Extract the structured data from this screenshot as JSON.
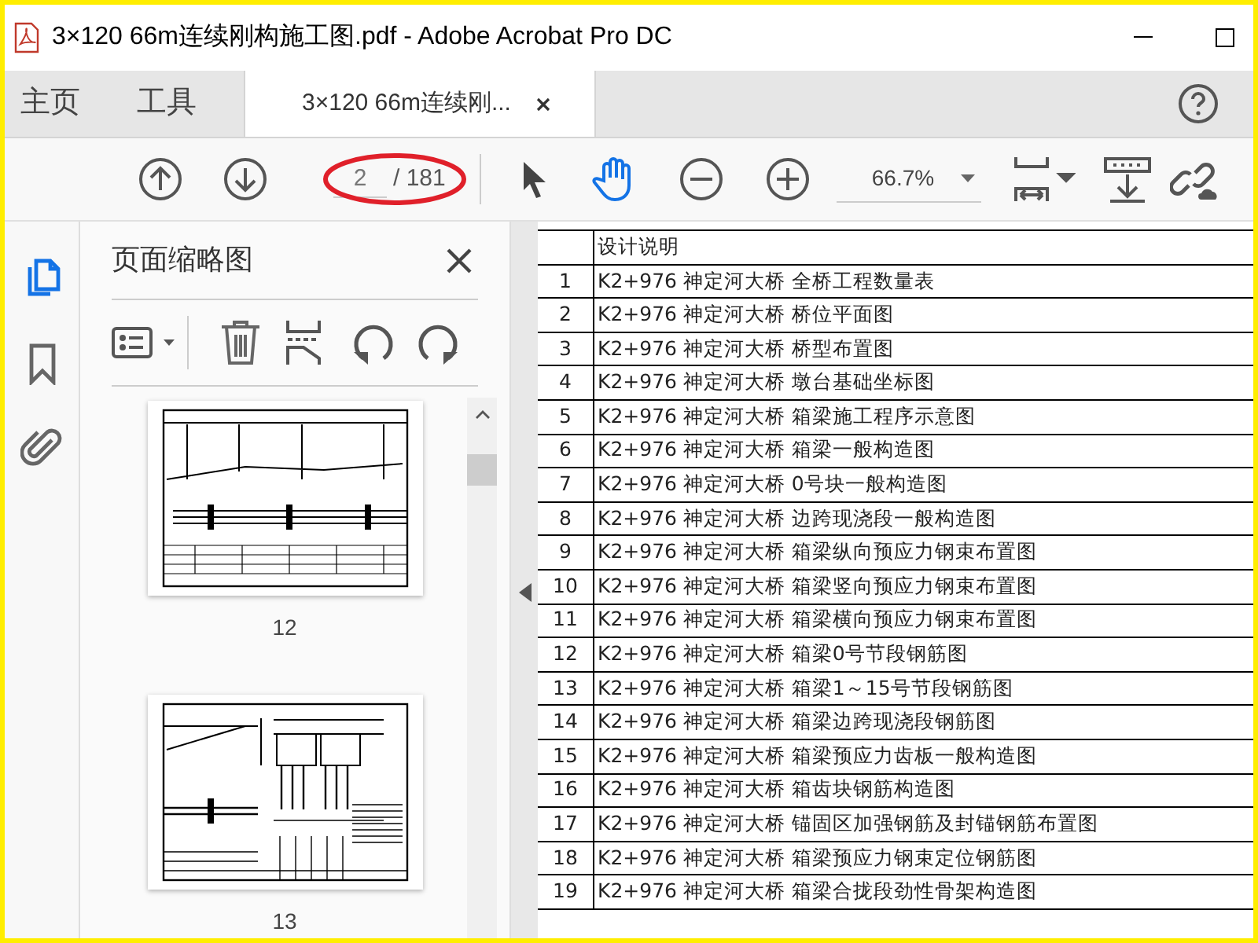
{
  "window": {
    "title": "3×120 66m连续刚构施工图.pdf - Adobe Acrobat Pro DC"
  },
  "tabs": [
    {
      "label": "主页",
      "selected": false
    },
    {
      "label": "工具",
      "selected": false
    },
    {
      "label": "3×120 66m连续刚...",
      "selected": true
    }
  ],
  "toolbar": {
    "page_input": "2",
    "page_total": "/ 181",
    "zoom": "66.7%",
    "hand_tool_selected": true
  },
  "side_rail": [
    {
      "kind": "pages",
      "selected": true
    },
    {
      "kind": "bookmarks",
      "selected": false
    },
    {
      "kind": "attachments",
      "selected": false
    }
  ],
  "panel": {
    "title": "页面缩略图",
    "thumbnails": [
      {
        "kind": "elevation",
        "label": "12"
      },
      {
        "kind": "pier",
        "label": "13"
      }
    ]
  },
  "document": {
    "rows": [
      {
        "number": "",
        "title": "设计说明"
      },
      {
        "number": "1",
        "title": "K2+976 神定河大桥 全桥工程数量表"
      },
      {
        "number": "2",
        "title": "K2+976 神定河大桥 桥位平面图"
      },
      {
        "number": "3",
        "title": "K2+976 神定河大桥 桥型布置图"
      },
      {
        "number": "4",
        "title": "K2+976 神定河大桥 墩台基础坐标图"
      },
      {
        "number": "5",
        "title": "K2+976 神定河大桥 箱梁施工程序示意图"
      },
      {
        "number": "6",
        "title": "K2+976 神定河大桥 箱梁一般构造图"
      },
      {
        "number": "7",
        "title": "K2+976 神定河大桥 0号块一般构造图"
      },
      {
        "number": "8",
        "title": "K2+976 神定河大桥 边跨现浇段一般构造图"
      },
      {
        "number": "9",
        "title": "K2+976 神定河大桥 箱梁纵向预应力钢束布置图"
      },
      {
        "number": "10",
        "title": "K2+976 神定河大桥 箱梁竖向预应力钢束布置图"
      },
      {
        "number": "11",
        "title": "K2+976 神定河大桥 箱梁横向预应力钢束布置图"
      },
      {
        "number": "12",
        "title": "K2+976 神定河大桥 箱梁0号节段钢筋图"
      },
      {
        "number": "13",
        "title": "K2+976 神定河大桥 箱梁1～15号节段钢筋图"
      },
      {
        "number": "14",
        "title": "K2+976 神定河大桥 箱梁边跨现浇段钢筋图"
      },
      {
        "number": "15",
        "title": "K2+976 神定河大桥 箱梁预应力齿板一般构造图"
      },
      {
        "number": "16",
        "title": "K2+976 神定河大桥 箱齿块钢筋构造图"
      },
      {
        "number": "17",
        "title": "K2+976 神定河大桥 锚固区加强钢筋及封锚钢筋布置图"
      },
      {
        "number": "18",
        "title": "K2+976 神定河大桥 箱梁预应力钢束定位钢筋图"
      },
      {
        "number": "19",
        "title": "K2+976 神定河大桥 箱梁合拢段劲性骨架构造图"
      }
    ]
  }
}
